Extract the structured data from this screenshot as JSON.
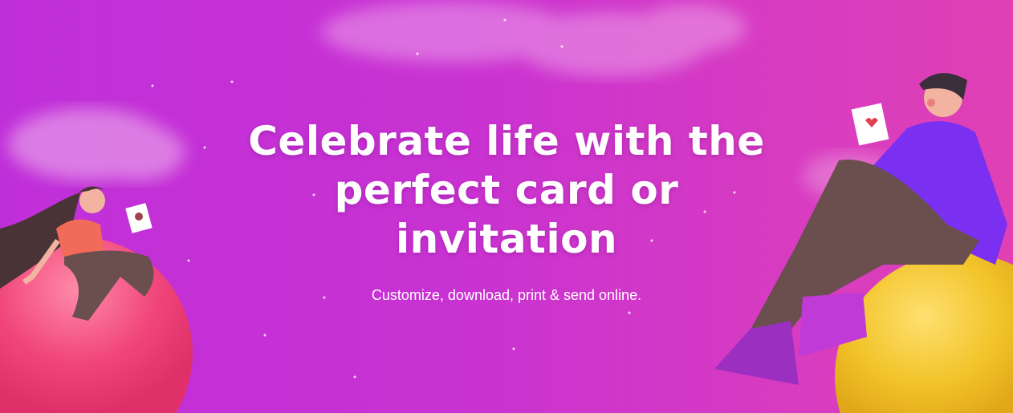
{
  "hero": {
    "headline": "Celebrate life with the perfect card or invitation",
    "subtitle": "Customize, download, print & send online."
  },
  "colors": {
    "background_left": "#bf2fd9",
    "background_right": "#e040b4",
    "pink_ball": "#f0457a",
    "yellow_ball": "#f2c42a",
    "sweater": "#7b2ff0"
  }
}
